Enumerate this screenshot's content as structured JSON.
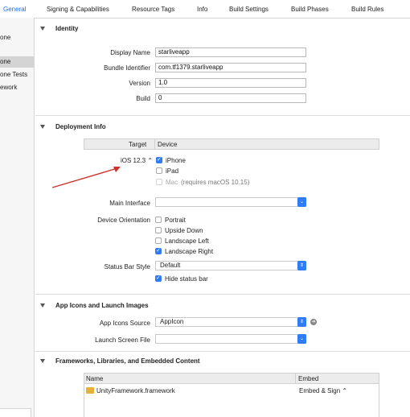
{
  "tabs": [
    {
      "label": "General",
      "active": true
    },
    {
      "label": "Signing & Capabilities"
    },
    {
      "label": "Resource Tags"
    },
    {
      "label": "Info"
    },
    {
      "label": "Build Settings"
    },
    {
      "label": "Build Phases"
    },
    {
      "label": "Build Rules"
    }
  ],
  "sidebar": {
    "items": [
      "one",
      "one",
      "one Tests",
      "ework"
    ]
  },
  "identity": {
    "title": "Identity",
    "display_name_label": "Display Name",
    "display_name": "starliveapp",
    "bundle_id_label": "Bundle Identifier",
    "bundle_id": "com.tf1379.starliveapp",
    "version_label": "Version",
    "version": "1.0",
    "build_label": "Build",
    "build": "0"
  },
  "deployment": {
    "title": "Deployment Info",
    "target_header": "Target",
    "device_header": "Device",
    "target_value": "iOS 12.3 ⌃",
    "devices": [
      "iPhone",
      "iPad",
      "Mac"
    ],
    "mac_note": "(requires macOS 10.15)",
    "main_interface_label": "Main Interface",
    "main_interface": "",
    "orientation_label": "Device Orientation",
    "orientations": [
      "Portrait",
      "Upside Down",
      "Landscape Left",
      "Landscape Right"
    ],
    "status_bar_label": "Status Bar Style",
    "status_bar": "Default",
    "hide_status_bar": "Hide status bar"
  },
  "app_icons": {
    "title": "App Icons and Launch Images",
    "source_label": "App Icons Source",
    "source": "AppIcon",
    "launch_label": "Launch Screen File",
    "launch": ""
  },
  "frameworks": {
    "title": "Frameworks, Libraries, and Embedded Content",
    "name_header": "Name",
    "embed_header": "Embed",
    "rows": [
      {
        "name": "UnityFramework.framework",
        "embed": "Embed & Sign ⌃"
      }
    ]
  },
  "colors": {
    "accent": "#2f7cf6",
    "annotation_arrow": "#d0312d"
  }
}
